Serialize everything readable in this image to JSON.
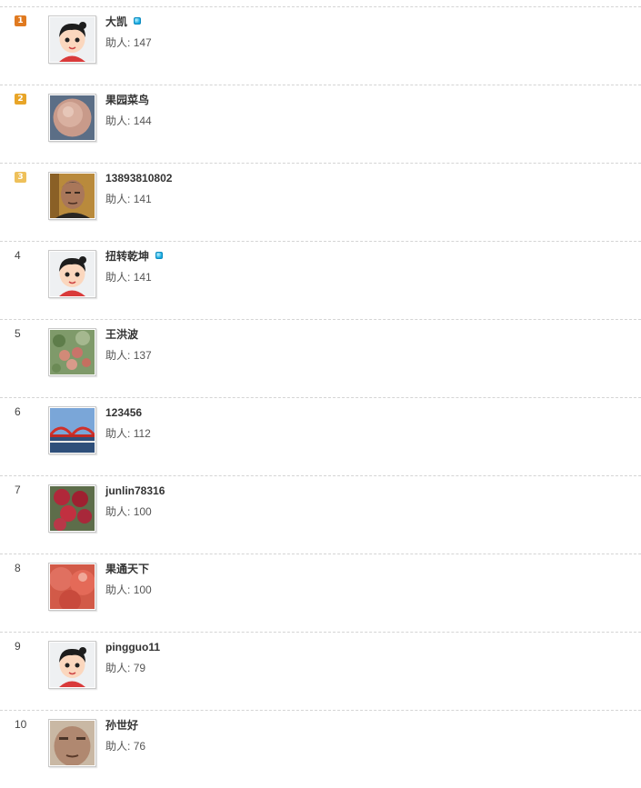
{
  "helped_label": "助人:",
  "colors": {
    "rank1": "#e07a20",
    "rank2": "#e8a528",
    "rank3": "#eec05a",
    "vip": "#14a8e0"
  },
  "ranking": [
    {
      "rank": "1",
      "name": "大凯",
      "helped": "147",
      "vip": true,
      "avatar": "cartoon-default-avatar"
    },
    {
      "rank": "2",
      "name": "果园菜鸟",
      "helped": "144",
      "vip": false,
      "avatar": "blurry-apple-photo"
    },
    {
      "rank": "3",
      "name": "13893810802",
      "helped": "141",
      "vip": false,
      "avatar": "man-portrait-photo"
    },
    {
      "rank": "4",
      "name": "扭转乾坤",
      "helped": "141",
      "vip": true,
      "avatar": "cartoon-default-avatar"
    },
    {
      "rank": "5",
      "name": "王洪波",
      "helped": "137",
      "vip": false,
      "avatar": "apple-tree-photo"
    },
    {
      "rank": "6",
      "name": "123456",
      "helped": "112",
      "vip": false,
      "avatar": "red-bridge-photo"
    },
    {
      "rank": "7",
      "name": "junlin78316",
      "helped": "100",
      "vip": false,
      "avatar": "red-apples-photo"
    },
    {
      "rank": "8",
      "name": "果通天下",
      "helped": "100",
      "vip": false,
      "avatar": "apples-closeup-photo"
    },
    {
      "rank": "9",
      "name": "pingguo11",
      "helped": "79",
      "vip": false,
      "avatar": "cartoon-default-avatar"
    },
    {
      "rank": "10",
      "name": "孙世好",
      "helped": "76",
      "vip": false,
      "avatar": "man-face-photo"
    }
  ]
}
